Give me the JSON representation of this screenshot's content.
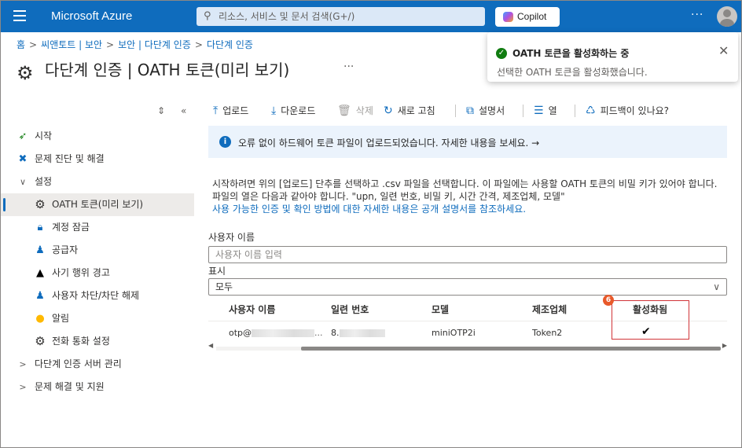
{
  "topbar": {
    "brand": "Microsoft Azure",
    "search_placeholder": "리소스, 서비스 및 문서 검색(G+/)",
    "copilot_label": "Copilot",
    "more": "···"
  },
  "breadcrumb": [
    "홈",
    "씨앤토트 | 보안",
    "보안 | 다단계 인증",
    "다단계 인증"
  ],
  "page": {
    "title": "다단계 인증 | OATH 토큰(미리 보기)",
    "more": "···"
  },
  "toast": {
    "title": "OATH 토큰을 활성화하는 중",
    "message": "선택한 OATH 토큰을 활성화했습니다."
  },
  "sidebar": {
    "items": [
      {
        "label": "시작"
      },
      {
        "label": "문제 진단 및 해결"
      },
      {
        "label": "설정"
      },
      {
        "label": "OATH 토큰(미리 보기)"
      },
      {
        "label": "계정 잠금"
      },
      {
        "label": "공급자"
      },
      {
        "label": "사기 행위 경고"
      },
      {
        "label": "사용자 차단/차단 해제"
      },
      {
        "label": "알림"
      },
      {
        "label": "전화 통화 설정"
      },
      {
        "label": "다단계 인증 서버 관리"
      },
      {
        "label": "문제 해결 및 지원"
      }
    ]
  },
  "toolbar": {
    "upload": "업로드",
    "download": "다운로드",
    "delete": "삭제",
    "refresh": "새로 고침",
    "docs": "설명서",
    "columns": "열",
    "feedback": "피드백이 있나요?"
  },
  "banner": {
    "text": "오류 없이 하드웨어 토큰 파일이 업로드되었습니다. 자세한 내용을 보세요. →"
  },
  "description": {
    "line1": "시작하려면 위의 [업로드] 단추를 선택하고 .csv 파일을 선택합니다. 이 파일에는 사용할 OATH 토큰의 비밀 키가 있어야 합니다. 파일의 열은 다음과 같아야 합니다. \"upn, 일련 번호, 비밀 키, 시간 간격, 제조업체, 모델\"",
    "link": "사용 가능한 인증 및 확인 방법에 대한 자세한 내용은 공개 설명서를 참조하세요."
  },
  "filters": {
    "username_label": "사용자 이름",
    "username_placeholder": "사용자 이름 입력",
    "display_label": "표시",
    "display_value": "모두"
  },
  "table": {
    "columns": [
      "사용자 이름",
      "일련 번호",
      "모델",
      "제조업체",
      "활성화됨"
    ],
    "rows": [
      {
        "user": "otp@",
        "serial": "8.",
        "model": "miniOTP2i",
        "vendor": "Token2",
        "activated": "✔"
      }
    ]
  },
  "callout": {
    "number": "6"
  },
  "colors": {
    "accent": "#0f6cbd",
    "callout": "#d13438",
    "badge": "#e8592a",
    "success": "#107c10"
  }
}
